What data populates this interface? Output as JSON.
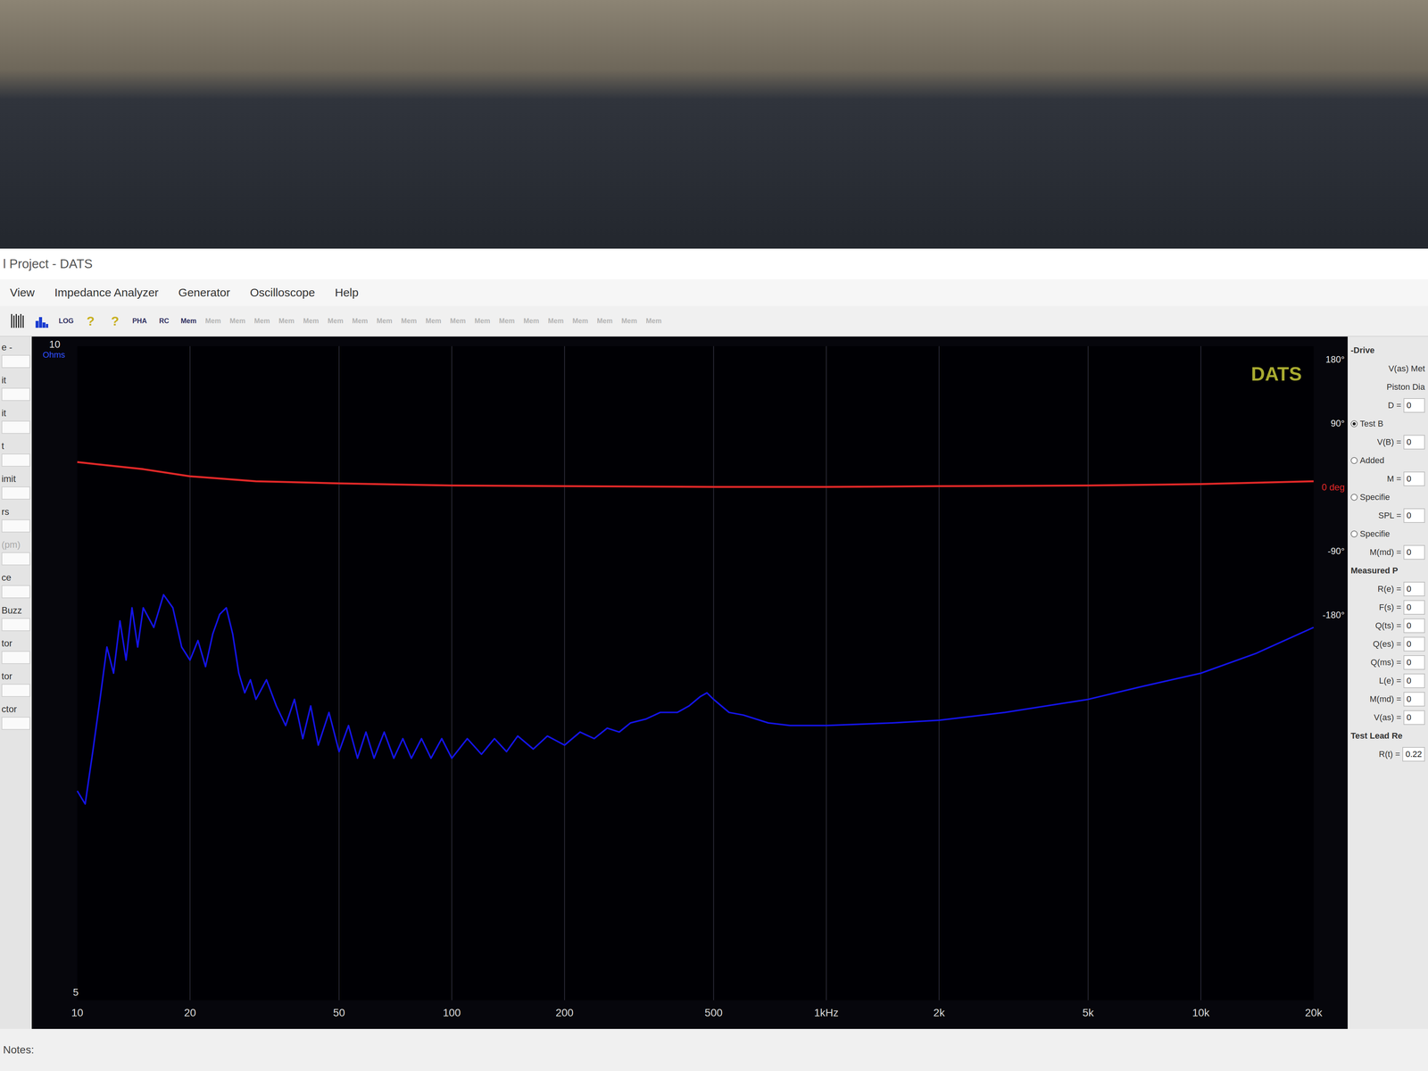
{
  "window": {
    "title": "l Project - DATS"
  },
  "menu": [
    "View",
    "Impedance Analyzer",
    "Generator",
    "Oscilloscope",
    "Help"
  ],
  "toolbar": [
    {
      "kind": "bars",
      "label": "",
      "disabled": false
    },
    {
      "kind": "histogram",
      "label": "",
      "disabled": false
    },
    {
      "kind": "text",
      "label": "LOG",
      "disabled": false
    },
    {
      "kind": "help",
      "label": "?",
      "disabled": false
    },
    {
      "kind": "help",
      "label": "?",
      "disabled": false
    },
    {
      "kind": "text",
      "label": "PHA",
      "disabled": false
    },
    {
      "kind": "text",
      "label": "RC",
      "disabled": false
    },
    {
      "kind": "text",
      "label": "Mem",
      "disabled": false
    },
    {
      "kind": "text",
      "label": "Mem",
      "disabled": true
    },
    {
      "kind": "text",
      "label": "Mem",
      "disabled": true
    },
    {
      "kind": "text",
      "label": "Mem",
      "disabled": true
    },
    {
      "kind": "text",
      "label": "Mem",
      "disabled": true
    },
    {
      "kind": "text",
      "label": "Mem",
      "disabled": true
    },
    {
      "kind": "text",
      "label": "Mem",
      "disabled": true
    },
    {
      "kind": "text",
      "label": "Mem",
      "disabled": true
    },
    {
      "kind": "text",
      "label": "Mem",
      "disabled": true
    },
    {
      "kind": "text",
      "label": "Mem",
      "disabled": true
    },
    {
      "kind": "text",
      "label": "Mem",
      "disabled": true
    },
    {
      "kind": "text",
      "label": "Mem",
      "disabled": true
    },
    {
      "kind": "text",
      "label": "Mem",
      "disabled": true
    },
    {
      "kind": "text",
      "label": "Mem",
      "disabled": true
    },
    {
      "kind": "text",
      "label": "Mem",
      "disabled": true
    },
    {
      "kind": "text",
      "label": "Mem",
      "disabled": true
    },
    {
      "kind": "text",
      "label": "Mem",
      "disabled": true
    },
    {
      "kind": "text",
      "label": "Mem",
      "disabled": true
    },
    {
      "kind": "text",
      "label": "Mem",
      "disabled": true
    },
    {
      "kind": "text",
      "label": "Mem",
      "disabled": true
    }
  ],
  "left_panel": {
    "items": [
      {
        "label": "e -",
        "disabled": false
      },
      {
        "label": "it",
        "disabled": false
      },
      {
        "label": "it",
        "disabled": false
      },
      {
        "label": "t",
        "disabled": false
      },
      {
        "label": "imit",
        "disabled": false
      },
      {
        "label": "rs",
        "disabled": false
      },
      {
        "label": "(pm)",
        "disabled": true
      },
      {
        "label": "ce",
        "disabled": false
      },
      {
        "label": "Buzz",
        "disabled": false
      },
      {
        "label": "tor",
        "disabled": false
      },
      {
        "label": "tor",
        "disabled": false
      },
      {
        "label": "ctor",
        "disabled": false
      }
    ]
  },
  "chart": {
    "logo": "DATS",
    "y_axis": {
      "unit": "Ohms",
      "ticks": [
        {
          "label": "10",
          "value": 10
        },
        {
          "label": "5",
          "value": 5
        }
      ]
    },
    "phase_axis": {
      "ticks": [
        {
          "label": "180°",
          "value": 180,
          "color": "#e8e8e8"
        },
        {
          "label": "90°",
          "value": 90,
          "color": "#e8e8e8"
        },
        {
          "label": "0 deg",
          "value": 0,
          "color": "#e02828"
        },
        {
          "label": "-90°",
          "value": -90,
          "color": "#e8e8e8"
        },
        {
          "label": "-180°",
          "value": -180,
          "color": "#e8e8e8"
        }
      ]
    },
    "x_axis": {
      "ticks": [
        {
          "label": "10",
          "value": 10
        },
        {
          "label": "20",
          "value": 20
        },
        {
          "label": "50",
          "value": 50
        },
        {
          "label": "100",
          "value": 100
        },
        {
          "label": "200",
          "value": 200
        },
        {
          "label": "500",
          "value": 500
        },
        {
          "label": "1kHz",
          "value": 1000
        },
        {
          "label": "2k",
          "value": 2000
        },
        {
          "label": "5k",
          "value": 5000
        },
        {
          "label": "10k",
          "value": 10000
        },
        {
          "label": "20k",
          "value": 20000
        }
      ]
    },
    "series": [
      {
        "kind": "impedance",
        "color": "#1414e6",
        "frequencies": [
          10,
          10.5,
          11,
          11.5,
          12,
          12.5,
          13,
          13.5,
          14,
          14.5,
          15,
          16,
          17,
          18,
          19,
          20,
          21,
          22,
          23,
          24,
          25,
          26,
          27,
          28,
          29,
          30,
          32,
          34,
          36,
          38,
          40,
          42,
          44,
          47,
          50,
          53,
          56,
          59,
          62,
          66,
          70,
          74,
          78,
          83,
          88,
          94,
          100,
          110,
          120,
          130,
          140,
          150,
          165,
          180,
          200,
          220,
          240,
          260,
          280,
          300,
          330,
          360,
          400,
          430,
          460,
          480,
          500,
          550,
          600,
          700,
          800,
          1000,
          1500,
          2000,
          3000,
          5000,
          7000,
          10000,
          14000,
          20000
        ],
        "values": [
          6.6,
          6.5,
          6.9,
          7.3,
          7.7,
          7.5,
          7.9,
          7.6,
          8.0,
          7.7,
          8.0,
          7.85,
          8.1,
          8.0,
          7.7,
          7.6,
          7.75,
          7.55,
          7.8,
          7.95,
          8.0,
          7.8,
          7.5,
          7.35,
          7.45,
          7.3,
          7.45,
          7.25,
          7.1,
          7.3,
          7.0,
          7.25,
          6.95,
          7.2,
          6.9,
          7.1,
          6.85,
          7.05,
          6.85,
          7.05,
          6.85,
          7.0,
          6.85,
          7.0,
          6.85,
          7.0,
          6.85,
          7.0,
          6.88,
          7.0,
          6.9,
          7.02,
          6.92,
          7.02,
          6.95,
          7.05,
          7.0,
          7.08,
          7.05,
          7.12,
          7.15,
          7.2,
          7.2,
          7.25,
          7.32,
          7.35,
          7.3,
          7.2,
          7.18,
          7.12,
          7.1,
          7.1,
          7.12,
          7.14,
          7.2,
          7.3,
          7.4,
          7.5,
          7.65,
          7.85
        ]
      },
      {
        "kind": "phase",
        "color": "#e02828",
        "frequencies": [
          10,
          15,
          20,
          30,
          50,
          100,
          200,
          500,
          1000,
          2000,
          5000,
          10000,
          20000
        ],
        "values": [
          35,
          25,
          15,
          8,
          5,
          2,
          1,
          0,
          0,
          1,
          2,
          4,
          8
        ]
      }
    ]
  },
  "right_panel": {
    "items": [
      {
        "label": "-Drive",
        "kind": "heading",
        "value": "",
        "selected": false
      },
      {
        "label": "V(as) Met",
        "kind": "text",
        "value": "",
        "selected": false
      },
      {
        "label": "Piston Dia",
        "kind": "text",
        "value": "",
        "selected": false
      },
      {
        "label": "D =",
        "kind": "field",
        "value": "0",
        "selected": false
      },
      {
        "label": "Test B",
        "kind": "radio",
        "value": "",
        "selected": true
      },
      {
        "label": "V(B) =",
        "kind": "field",
        "value": "0",
        "selected": false
      },
      {
        "label": "Added",
        "kind": "radio",
        "value": "",
        "selected": false
      },
      {
        "label": "M =",
        "kind": "field",
        "value": "0",
        "selected": false
      },
      {
        "label": "Specifie",
        "kind": "radio",
        "value": "",
        "selected": false
      },
      {
        "label": "SPL =",
        "kind": "field",
        "value": "0",
        "selected": false
      },
      {
        "label": "Specifie",
        "kind": "radio",
        "value": "",
        "selected": false
      },
      {
        "label": "M(md) =",
        "kind": "field",
        "value": "0",
        "selected": false
      },
      {
        "label": "Measured P",
        "kind": "heading",
        "value": "",
        "selected": false
      },
      {
        "label": "R(e) =",
        "kind": "field",
        "value": "0",
        "selected": false
      },
      {
        "label": "F(s) =",
        "kind": "field",
        "value": "0",
        "selected": false
      },
      {
        "label": "Q(ts) =",
        "kind": "field",
        "value": "0",
        "selected": false
      },
      {
        "label": "Q(es) =",
        "kind": "field",
        "value": "0",
        "selected": false
      },
      {
        "label": "Q(ms) =",
        "kind": "field",
        "value": "0",
        "selected": false
      },
      {
        "label": "L(e) =",
        "kind": "field",
        "value": "0",
        "selected": false
      },
      {
        "label": "M(md) =",
        "kind": "field",
        "value": "0",
        "selected": false
      },
      {
        "label": "V(as) =",
        "kind": "field",
        "value": "0",
        "selected": false
      },
      {
        "label": "Test Lead Re",
        "kind": "heading",
        "value": "",
        "selected": false
      },
      {
        "label": "R(t) =",
        "kind": "field",
        "value": "0.22",
        "selected": false
      }
    ]
  },
  "notes": {
    "label": "Notes:"
  }
}
